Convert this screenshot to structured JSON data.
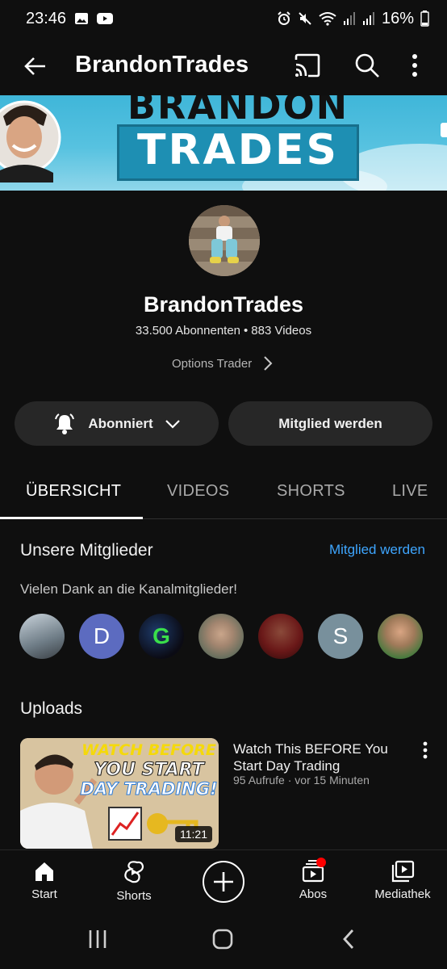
{
  "status_bar": {
    "time": "23:46",
    "battery": "16%",
    "icons": [
      "gallery-icon",
      "youtube-icon",
      "alarm-icon",
      "mute-icon",
      "wifi-icon",
      "signal-icon",
      "signal-icon",
      "battery-icon"
    ]
  },
  "app_bar": {
    "title": "BrandonTrades",
    "icons": [
      "back-arrow-icon",
      "cast-icon",
      "search-icon",
      "more-vert-icon"
    ]
  },
  "banner": {
    "line1": "BRANDON",
    "line2": "TRADES"
  },
  "channel": {
    "name": "BrandonTrades",
    "subscribers": "33.500 Abonnenten",
    "videos": "883 Videos",
    "description": "Options Trader"
  },
  "buttons": {
    "subscribed": "Abonniert",
    "join": "Mitglied werden"
  },
  "tabs": [
    {
      "label": "ÜBERSICHT",
      "active": true
    },
    {
      "label": "VIDEOS",
      "active": false
    },
    {
      "label": "SHORTS",
      "active": false
    },
    {
      "label": "LIVE",
      "active": false
    }
  ],
  "members_section": {
    "title": "Unsere Mitglieder",
    "link": "Mitglied werden",
    "subtitle": "Vielen Dank an die Kanalmitglieder!",
    "members": [
      {
        "initial": "",
        "color": "#8a9aa6"
      },
      {
        "initial": "D",
        "color": "#5c6bc0"
      },
      {
        "initial": "G",
        "color": "#1a1a2e"
      },
      {
        "initial": "",
        "color": "#7a6a5a"
      },
      {
        "initial": "",
        "color": "#a32020"
      },
      {
        "initial": "S",
        "color": "#78909c"
      },
      {
        "initial": "",
        "color": "#4a7a3a"
      }
    ]
  },
  "uploads": {
    "title": "Uploads",
    "video": {
      "thumb_line1": "WATCH BEFORE",
      "thumb_line2": "YOU START",
      "thumb_line3": "DAY TRADING!",
      "duration": "11:21",
      "title": "Watch This BEFORE You Start Day Trading",
      "views": "95 Aufrufe",
      "age": "vor 15 Minuten"
    }
  },
  "bottom_nav": [
    {
      "label": "Start",
      "icon": "home-icon"
    },
    {
      "label": "Shorts",
      "icon": "shorts-icon"
    },
    {
      "label": "",
      "icon": "create-icon"
    },
    {
      "label": "Abos",
      "icon": "subscriptions-icon"
    },
    {
      "label": "Mediathek",
      "icon": "library-icon"
    }
  ]
}
